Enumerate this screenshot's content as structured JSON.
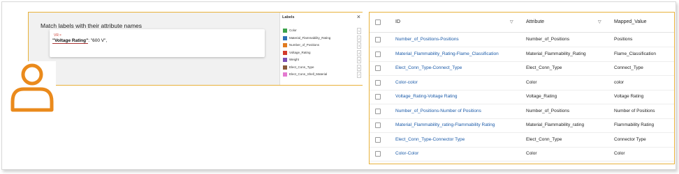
{
  "annotation": {
    "task_title": "Match labels with their attribute names",
    "tag_label": "VR",
    "tag_close": "×",
    "sample_key": "\"Voltage Rating\"",
    "sample_rest": ": \"600 V\","
  },
  "labels_panel": {
    "title": "Labels",
    "close": "×",
    "items": [
      {
        "label": "Color",
        "color": "#3aa24a",
        "count": "1"
      },
      {
        "label": "Material_Flammability_Rating",
        "color": "#2b6fb6",
        "count": "2"
      },
      {
        "label": "Number_of_Positions",
        "color": "#e07a1f",
        "count": "3"
      },
      {
        "label": "Voltage_Rating",
        "color": "#d23a2c",
        "count": "4"
      },
      {
        "label": "Weight",
        "color": "#7b4fb4",
        "count": "5"
      },
      {
        "label": "Elect_Conn_Type",
        "color": "#8a5a3a",
        "count": "6"
      },
      {
        "label": "Elect_Conn_Shell_Material",
        "color": "#e47ad0",
        "count": "7"
      }
    ]
  },
  "table": {
    "headers": {
      "id": "ID",
      "attribute": "Attribute",
      "mapped": "Mapped_Value"
    },
    "rows": [
      {
        "id": "Number_of_Positions-Positions",
        "attribute": "Number_of_Positions",
        "mapped": "Positions"
      },
      {
        "id": "Material_Flammability_Rating-Flame_Classification",
        "attribute": "Material_Flammability_Rating",
        "mapped": "Flame_Classification"
      },
      {
        "id": "Elect_Conn_Type-Connect_Type",
        "attribute": "Elect_Conn_Type",
        "mapped": "Connect_Type"
      },
      {
        "id": "Color-color",
        "attribute": "Color",
        "mapped": "color"
      },
      {
        "id": "Voltage_Rating-Voltage Rating",
        "attribute": "Voltage_Rating",
        "mapped": "Voltage Rating"
      },
      {
        "id": "Number_of_Positions-Number of Positions",
        "attribute": "Number_of_Positions",
        "mapped": "Number of Positions"
      },
      {
        "id": "Material_Flammability_rating-Flammability Rating",
        "attribute": "Material_Flammability_rating",
        "mapped": "Flammability Rating"
      },
      {
        "id": "Elect_Conn_Type-Connector Type",
        "attribute": "Elect_Conn_Type",
        "mapped": "Connector Type"
      },
      {
        "id": "Color-Color",
        "attribute": "Color",
        "mapped": "Color"
      }
    ]
  },
  "colors": {
    "accent_border": "#e8b13a",
    "link": "#1a5aa8",
    "person_icon": "#ea8a1c"
  }
}
